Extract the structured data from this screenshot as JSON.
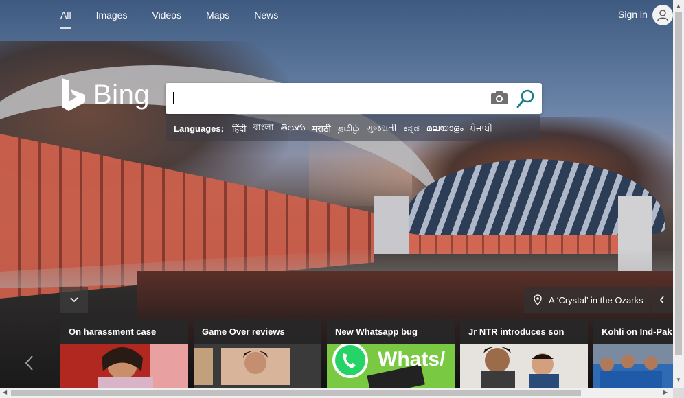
{
  "nav": {
    "items": [
      {
        "label": "All",
        "active": true
      },
      {
        "label": "Images",
        "active": false
      },
      {
        "label": "Videos",
        "active": false
      },
      {
        "label": "Maps",
        "active": false
      },
      {
        "label": "News",
        "active": false
      }
    ],
    "signin_label": "Sign in"
  },
  "logo": {
    "text": "Bing"
  },
  "search": {
    "value": "",
    "placeholder": ""
  },
  "languages": {
    "label": "Languages:",
    "items": [
      "हिंदी",
      "বাংলা",
      "తెలుగు",
      "मराठी",
      "தமிழ்",
      "ગુજરાતી",
      "ಕನ್ನಡ",
      "മലയാളം",
      "ਪੰਜਾਬੀ"
    ]
  },
  "caption": {
    "text": "A ‘Crystal’ in the Ozarks"
  },
  "cards": [
    {
      "title": "On harassment case",
      "thumb": "woman-portrait"
    },
    {
      "title": "Game Over reviews",
      "thumb": "movie-still"
    },
    {
      "title": "New Whatsapp bug",
      "thumb": "whatsapp-logo",
      "thumb_text": "Whats/"
    },
    {
      "title": "Jr NTR introduces son",
      "thumb": "father-and-baby"
    },
    {
      "title": "Kohli on Ind-Pak m",
      "thumb": "cricket-team"
    }
  ],
  "colors": {
    "accent": "#177e89",
    "whatsapp_green": "#25d366",
    "panel": "#2b2b2b"
  }
}
